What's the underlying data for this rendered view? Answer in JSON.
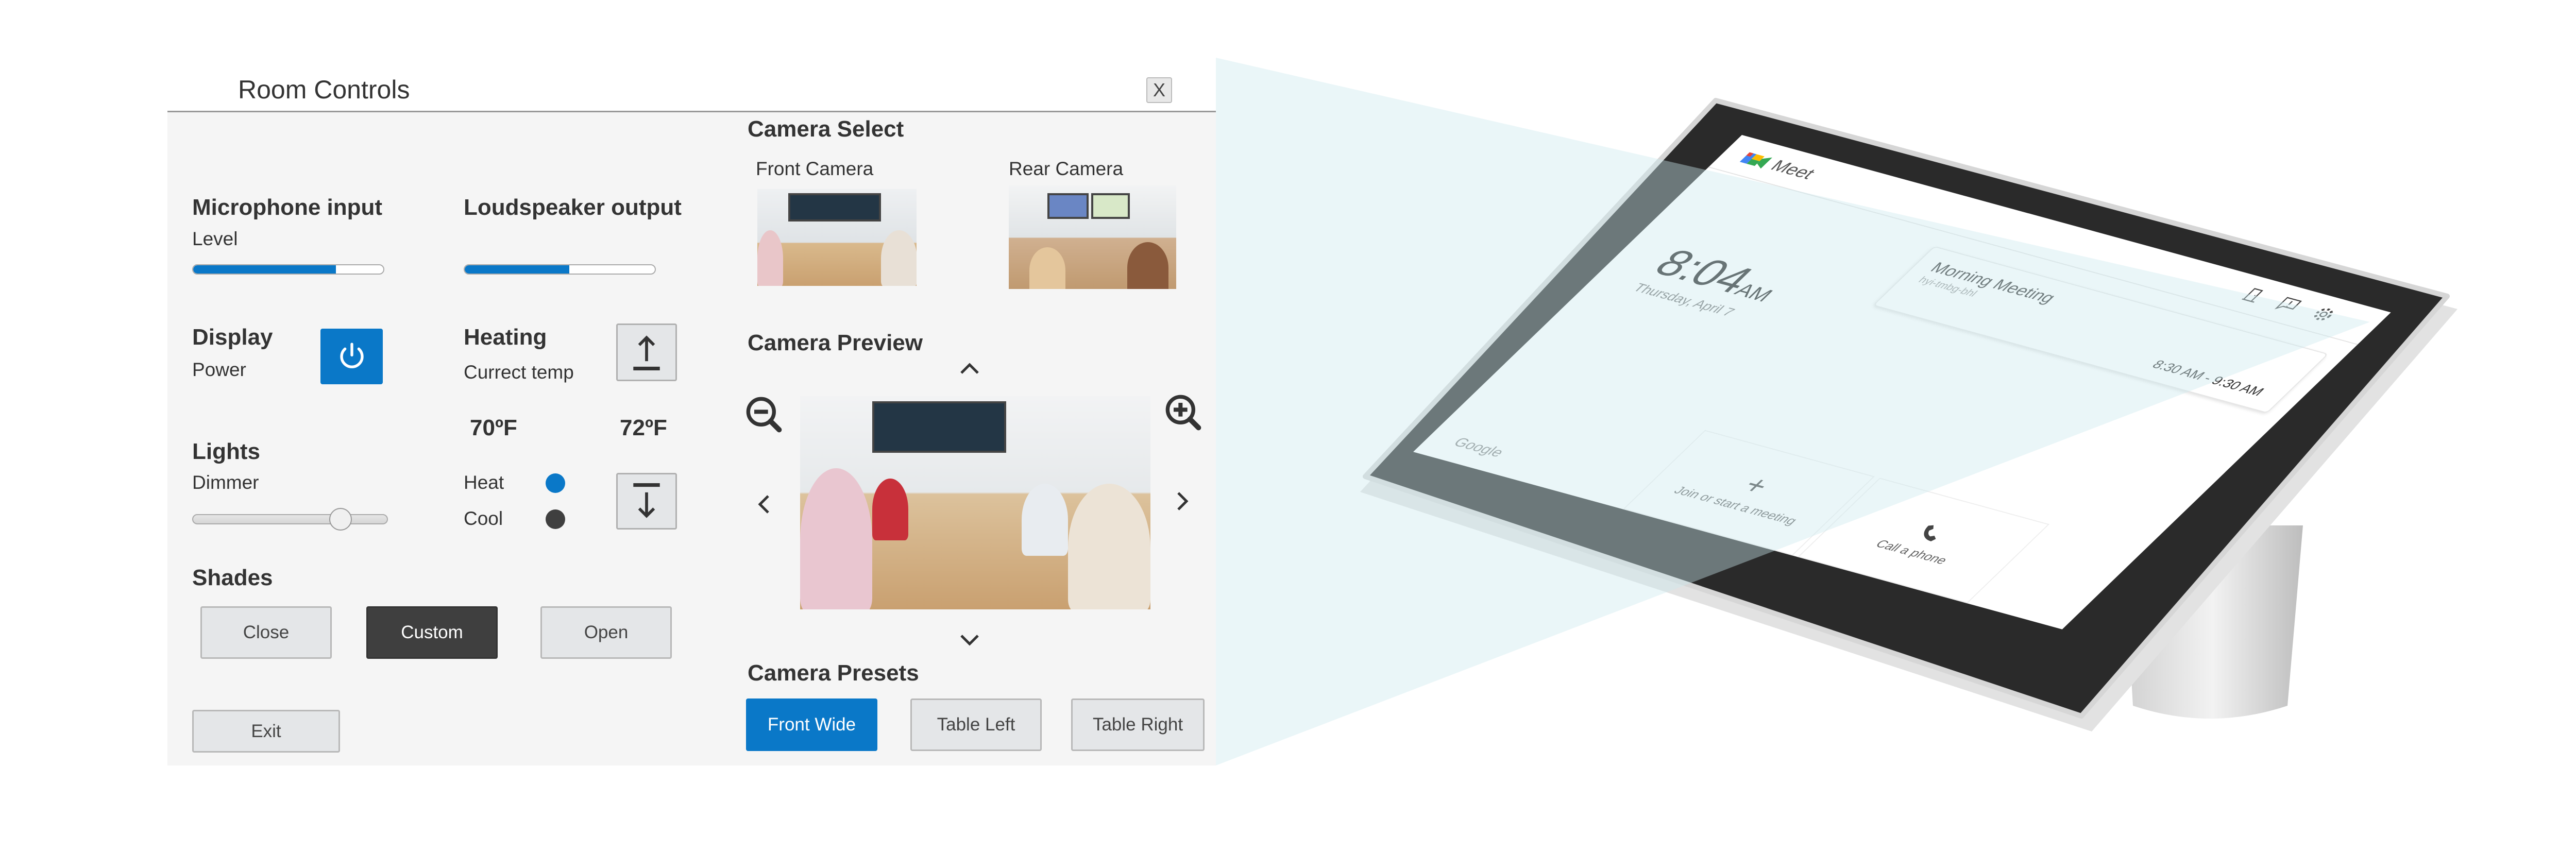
{
  "panel": {
    "title": "Room Controls",
    "close_label": "X",
    "microphone": {
      "heading": "Microphone input",
      "sub": "Level",
      "level_percent": 75
    },
    "loudspeaker": {
      "heading": "Loudspeaker output",
      "level_percent": 55
    },
    "display": {
      "heading": "Display",
      "sub": "Power",
      "icon": "power-icon",
      "accent": "#0a78c8"
    },
    "heating": {
      "heading": "Heating",
      "sub": "Currect temp",
      "current_temp": "70ºF",
      "set_temp": "72ºF",
      "up_icon": "arrow-up-to-bar-icon",
      "down_icon": "arrow-down-from-bar-icon",
      "modes": [
        {
          "label": "Heat",
          "color": "#0a78c8"
        },
        {
          "label": "Cool",
          "color": "#3f3f3f"
        }
      ]
    },
    "lights": {
      "heading": "Lights",
      "sub": "Dimmer",
      "dimmer_percent": 76
    },
    "shades": {
      "heading": "Shades",
      "buttons": [
        "Close",
        "Custom",
        "Open"
      ],
      "selected": "Custom"
    },
    "exit_label": "Exit",
    "camera_select": {
      "heading": "Camera Select",
      "cameras": [
        "Front Camera",
        "Rear Camera"
      ]
    },
    "camera_preview": {
      "heading": "Camera Preview"
    },
    "camera_presets": {
      "heading": "Camera Presets",
      "buttons": [
        "Front Wide",
        "Table Left",
        "Table Right"
      ],
      "selected": "Front Wide"
    }
  },
  "device": {
    "app_name": "Meet",
    "time": "8:04",
    "ampm": "AM",
    "date": "Thursday, April 7",
    "meeting": {
      "title": "Morning Meeting",
      "code": "hyi-tmbg-bhl",
      "time_range": "8:30 AM - 9:30 AM"
    },
    "footer_brand": "Google",
    "actions": [
      "Join or start a meeting",
      "Call a phone"
    ],
    "beam_color": "#cbe8ed"
  }
}
